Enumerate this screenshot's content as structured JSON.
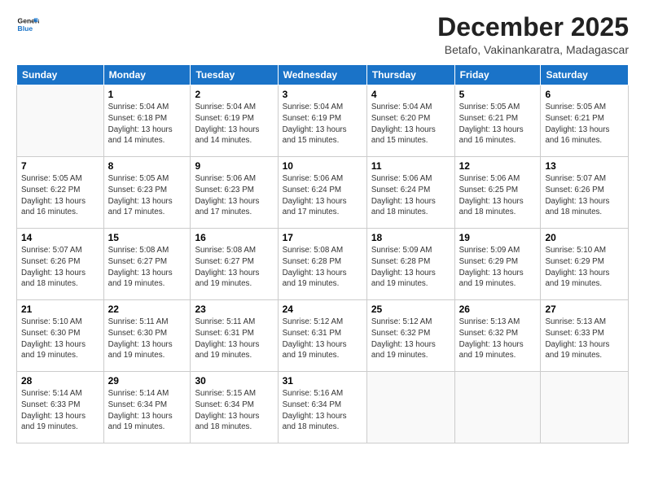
{
  "header": {
    "logo_line1": "General",
    "logo_line2": "Blue",
    "month_title": "December 2025",
    "subtitle": "Betafo, Vakinankaratra, Madagascar"
  },
  "weekdays": [
    "Sunday",
    "Monday",
    "Tuesday",
    "Wednesday",
    "Thursday",
    "Friday",
    "Saturday"
  ],
  "weeks": [
    [
      {
        "day": "",
        "info": ""
      },
      {
        "day": "1",
        "info": "Sunrise: 5:04 AM\nSunset: 6:18 PM\nDaylight: 13 hours\nand 14 minutes."
      },
      {
        "day": "2",
        "info": "Sunrise: 5:04 AM\nSunset: 6:19 PM\nDaylight: 13 hours\nand 14 minutes."
      },
      {
        "day": "3",
        "info": "Sunrise: 5:04 AM\nSunset: 6:19 PM\nDaylight: 13 hours\nand 15 minutes."
      },
      {
        "day": "4",
        "info": "Sunrise: 5:04 AM\nSunset: 6:20 PM\nDaylight: 13 hours\nand 15 minutes."
      },
      {
        "day": "5",
        "info": "Sunrise: 5:05 AM\nSunset: 6:21 PM\nDaylight: 13 hours\nand 16 minutes."
      },
      {
        "day": "6",
        "info": "Sunrise: 5:05 AM\nSunset: 6:21 PM\nDaylight: 13 hours\nand 16 minutes."
      }
    ],
    [
      {
        "day": "7",
        "info": ""
      },
      {
        "day": "8",
        "info": "Sunrise: 5:05 AM\nSunset: 6:23 PM\nDaylight: 13 hours\nand 17 minutes."
      },
      {
        "day": "9",
        "info": "Sunrise: 5:06 AM\nSunset: 6:23 PM\nDaylight: 13 hours\nand 17 minutes."
      },
      {
        "day": "10",
        "info": "Sunrise: 5:06 AM\nSunset: 6:24 PM\nDaylight: 13 hours\nand 17 minutes."
      },
      {
        "day": "11",
        "info": "Sunrise: 5:06 AM\nSunset: 6:24 PM\nDaylight: 13 hours\nand 18 minutes."
      },
      {
        "day": "12",
        "info": "Sunrise: 5:06 AM\nSunset: 6:25 PM\nDaylight: 13 hours\nand 18 minutes."
      },
      {
        "day": "13",
        "info": "Sunrise: 5:07 AM\nSunset: 6:26 PM\nDaylight: 13 hours\nand 18 minutes."
      }
    ],
    [
      {
        "day": "14",
        "info": ""
      },
      {
        "day": "15",
        "info": "Sunrise: 5:08 AM\nSunset: 6:27 PM\nDaylight: 13 hours\nand 19 minutes."
      },
      {
        "day": "16",
        "info": "Sunrise: 5:08 AM\nSunset: 6:27 PM\nDaylight: 13 hours\nand 19 minutes."
      },
      {
        "day": "17",
        "info": "Sunrise: 5:08 AM\nSunset: 6:28 PM\nDaylight: 13 hours\nand 19 minutes."
      },
      {
        "day": "18",
        "info": "Sunrise: 5:09 AM\nSunset: 6:28 PM\nDaylight: 13 hours\nand 19 minutes."
      },
      {
        "day": "19",
        "info": "Sunrise: 5:09 AM\nSunset: 6:29 PM\nDaylight: 13 hours\nand 19 minutes."
      },
      {
        "day": "20",
        "info": "Sunrise: 5:10 AM\nSunset: 6:29 PM\nDaylight: 13 hours\nand 19 minutes."
      }
    ],
    [
      {
        "day": "21",
        "info": ""
      },
      {
        "day": "22",
        "info": "Sunrise: 5:11 AM\nSunset: 6:30 PM\nDaylight: 13 hours\nand 19 minutes."
      },
      {
        "day": "23",
        "info": "Sunrise: 5:11 AM\nSunset: 6:31 PM\nDaylight: 13 hours\nand 19 minutes."
      },
      {
        "day": "24",
        "info": "Sunrise: 5:12 AM\nSunset: 6:31 PM\nDaylight: 13 hours\nand 19 minutes."
      },
      {
        "day": "25",
        "info": "Sunrise: 5:12 AM\nSunset: 6:32 PM\nDaylight: 13 hours\nand 19 minutes."
      },
      {
        "day": "26",
        "info": "Sunrise: 5:13 AM\nSunset: 6:32 PM\nDaylight: 13 hours\nand 19 minutes."
      },
      {
        "day": "27",
        "info": "Sunrise: 5:13 AM\nSunset: 6:33 PM\nDaylight: 13 hours\nand 19 minutes."
      }
    ],
    [
      {
        "day": "28",
        "info": "Sunrise: 5:14 AM\nSunset: 6:33 PM\nDaylight: 13 hours\nand 19 minutes."
      },
      {
        "day": "29",
        "info": "Sunrise: 5:14 AM\nSunset: 6:34 PM\nDaylight: 13 hours\nand 19 minutes."
      },
      {
        "day": "30",
        "info": "Sunrise: 5:15 AM\nSunset: 6:34 PM\nDaylight: 13 hours\nand 18 minutes."
      },
      {
        "day": "31",
        "info": "Sunrise: 5:16 AM\nSunset: 6:34 PM\nDaylight: 13 hours\nand 18 minutes."
      },
      {
        "day": "",
        "info": ""
      },
      {
        "day": "",
        "info": ""
      },
      {
        "day": "",
        "info": ""
      }
    ]
  ]
}
